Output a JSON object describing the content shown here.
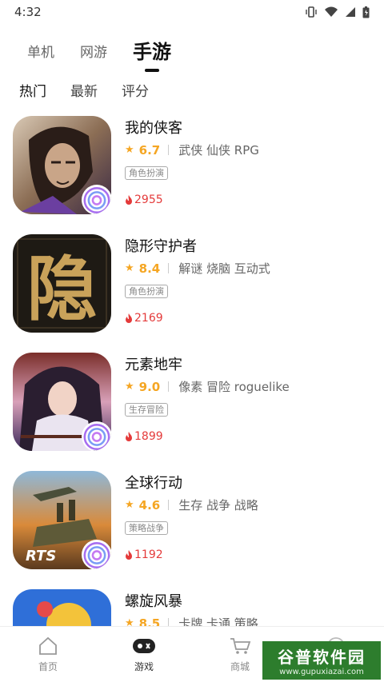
{
  "status": {
    "time": "4:32"
  },
  "main_tabs": [
    {
      "label": "单机"
    },
    {
      "label": "网游"
    },
    {
      "label": "手游"
    }
  ],
  "sub_tabs": [
    {
      "label": "热门"
    },
    {
      "label": "最新"
    },
    {
      "label": "评分"
    }
  ],
  "games": [
    {
      "title": "我的侠客",
      "rating": "6.7",
      "genres": "武侠 仙侠 RPG",
      "tag": "角色扮演",
      "heat": "2955"
    },
    {
      "title": "隐形守护者",
      "rating": "8.4",
      "genres": "解谜 烧脑 互动式",
      "tag": "角色扮演",
      "heat": "2169",
      "icon_char": "隐"
    },
    {
      "title": "元素地牢",
      "rating": "9.0",
      "genres": "像素 冒险 roguelike",
      "tag": "生存冒险",
      "heat": "1899"
    },
    {
      "title": "全球行动",
      "rating": "4.6",
      "genres": "生存 战争 战略",
      "tag": "策略战争",
      "heat": "1192",
      "icon_text": "RTS"
    },
    {
      "title": "螺旋风暴",
      "rating": "8.5",
      "genres": "卡牌 卡通 策略",
      "tag": "",
      "heat": ""
    }
  ],
  "bottom_nav": [
    {
      "label": "首页",
      "icon": "home-icon"
    },
    {
      "label": "游戏",
      "icon": "gamepad-icon"
    },
    {
      "label": "商城",
      "icon": "cart-icon"
    },
    {
      "label": "",
      "icon": "profile-icon"
    }
  ],
  "watermark": {
    "title": "谷普软件园",
    "url": "www.gupuxiazai.com"
  },
  "colors": {
    "accent": "#f5a623",
    "heat": "#e43a3a",
    "watermark": "#2d7d2d"
  }
}
